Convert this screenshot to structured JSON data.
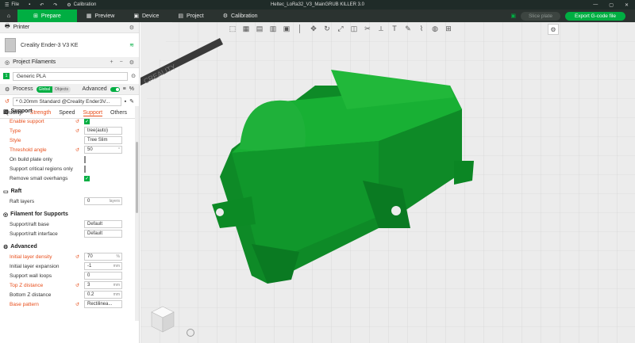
{
  "titlebar": {
    "file": "File",
    "calibration": "Calibration",
    "title": "Heltec_LoRa32_V3_MainGRUB KILLER 3.0",
    "icons": [
      "save-icon",
      "undo-icon",
      "redo-icon",
      "calibration-icon"
    ]
  },
  "toolbar": {
    "tabs": [
      {
        "label": "Prepare",
        "icon": "prepare-icon",
        "active": true
      },
      {
        "label": "Preview",
        "icon": "preview-icon"
      },
      {
        "label": "Device",
        "icon": "device-icon"
      },
      {
        "label": "Project",
        "icon": "project-icon"
      },
      {
        "label": "Calibration",
        "icon": "calibration-icon"
      }
    ],
    "slice_label": "Slice plate",
    "export_label": "Export G-code file"
  },
  "printer": {
    "header": "Printer",
    "name": "Creality Ender-3 V3 KE"
  },
  "filaments": {
    "header": "Project Filaments",
    "index": "1",
    "value": "Generic PLA"
  },
  "process": {
    "header": "Process",
    "global": "Global",
    "objects": "Objects",
    "advanced": "Advanced",
    "preset": "* 0.20mm Standard @Creality Ender3V...",
    "tabs": [
      "Quality",
      "Strength",
      "Speed",
      "Support",
      "Others"
    ],
    "active_tab": "Support"
  },
  "support": {
    "title": "Support",
    "enable_support": "Enable support",
    "type_label": "Type",
    "type_value": "tree(auto)",
    "style_label": "Style",
    "style_value": "Tree Slim",
    "threshold_label": "Threshold angle",
    "threshold_value": "50",
    "threshold_unit": "°",
    "build_plate_only": "On build plate only",
    "critical_regions": "Support critical regions only",
    "small_overhangs": "Remove small overhangs"
  },
  "raft": {
    "title": "Raft",
    "layers_label": "Raft layers",
    "layers_value": "0",
    "layers_unit": "layers"
  },
  "filament_supports": {
    "title": "Filament for Supports",
    "base_label": "Support/raft base",
    "base_value": "Default",
    "interface_label": "Support/raft interface",
    "interface_value": "Default"
  },
  "advanced": {
    "title": "Advanced",
    "density_label": "Initial layer density",
    "density_value": "70",
    "density_unit": "%",
    "expansion_label": "Initial layer expansion",
    "expansion_value": "-1",
    "expansion_unit": "mm",
    "wall_loops_label": "Support wall loops",
    "wall_loops_value": "0",
    "top_z_label": "Top Z distance",
    "top_z_value": "3",
    "top_z_unit": "mm",
    "bottom_z_label": "Bottom Z distance",
    "bottom_z_value": "0.2",
    "bottom_z_unit": "mm",
    "base_pattern_label": "Base pattern",
    "base_pattern_value": "Rectilinea..."
  },
  "viewport": {
    "bed_label": "CREALITY",
    "model_color": "#129e2e"
  },
  "colors": {
    "accent": "#00ae42",
    "modified": "#e84e1b"
  }
}
